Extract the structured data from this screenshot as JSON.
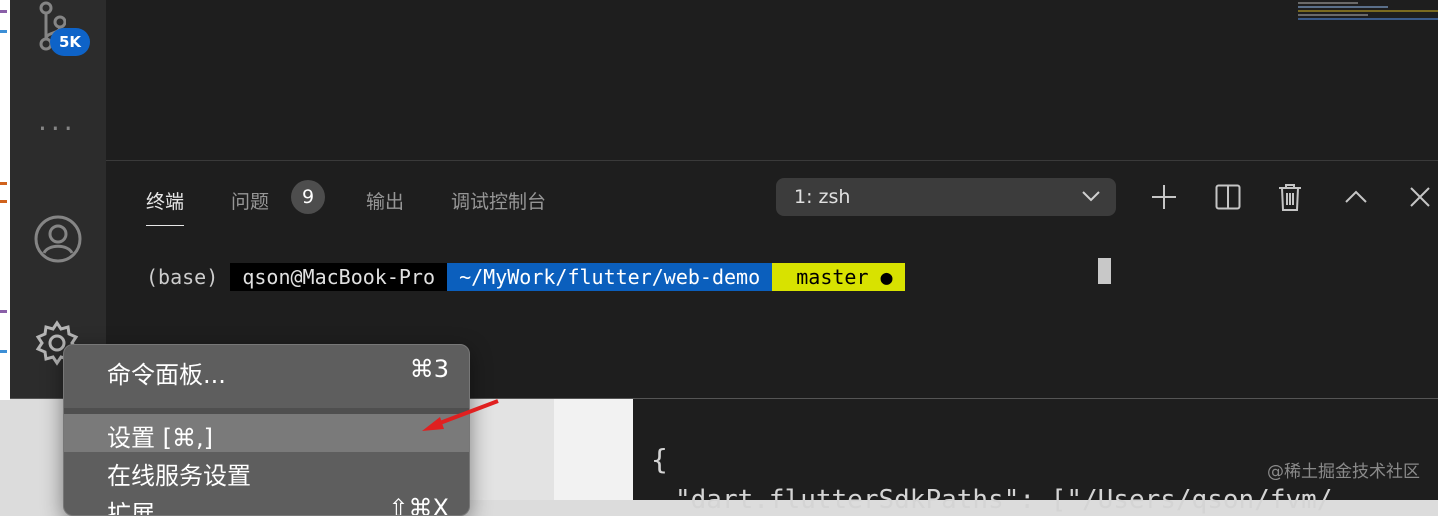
{
  "activity_bar": {
    "scm_badge": "5K",
    "more": "···"
  },
  "panel": {
    "tabs": [
      "终端",
      "问题",
      "输出",
      "调试控制台"
    ],
    "problems_count": "9",
    "terminal_select": "1: zsh"
  },
  "terminal": {
    "env": "(base) ",
    "host": " qson@MacBook-Pro ",
    "sep1": "",
    "path": " ~/MyWork/flutter/web-demo ",
    "sep2": "",
    "branch_icon": " ",
    "branch": " master ● ",
    "sep3": ""
  },
  "context_menu": {
    "items": [
      {
        "label": "命令面板...",
        "shortcut": "⌘3"
      },
      {
        "label": "设置 [⌘,]",
        "shortcut": ""
      },
      {
        "label": "在线服务设置",
        "shortcut": ""
      },
      {
        "label": "扩展",
        "shortcut": "⇧⌘X"
      }
    ]
  },
  "editor_snippet": {
    "brace": "{",
    "line": "\"dart.flutterSdkPaths\": [\"/Users/qson/fvm/"
  },
  "watermark": "@稀土掘金技术社区",
  "colors": {
    "path_bg": "#0b5fbd",
    "git_bg": "#d8e200",
    "badge": "#0e63c8",
    "arrow": "#e02020"
  }
}
